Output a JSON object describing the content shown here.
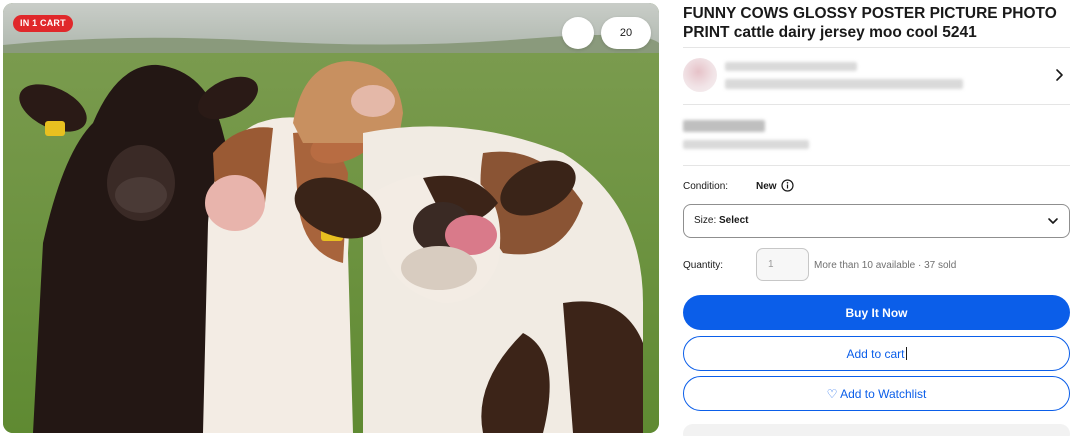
{
  "image": {
    "alt": "Group of cows looking at the camera, one licking its nose",
    "badge": "IN 1 CART",
    "watch_count": "20",
    "icons": {
      "expand": "expand-arrows-icon",
      "watch": "heart-icon"
    }
  },
  "product": {
    "title": "FUNNY COWS GLOSSY POSTER PICTURE PHOTO PRINT cattle dairy jersey moo cool 5241"
  },
  "seller": {
    "chevron": "chevron-right-icon"
  },
  "condition": {
    "label": "Condition:",
    "value": "New",
    "icon": "info-icon"
  },
  "size": {
    "label": "Size: ",
    "value": "Select",
    "icon": "chevron-down-icon"
  },
  "quantity": {
    "label": "Quantity:",
    "value": "1",
    "availability": "More than 10 available · 37 sold"
  },
  "buttons": {
    "buy_now": "Buy It Now",
    "add_to_cart": "Add to cart",
    "add_to_watchlist": "♡ Add to Watchlist"
  },
  "colors": {
    "primary": "#0b5ee9",
    "badge": "#e0282b",
    "text": "#191919"
  }
}
